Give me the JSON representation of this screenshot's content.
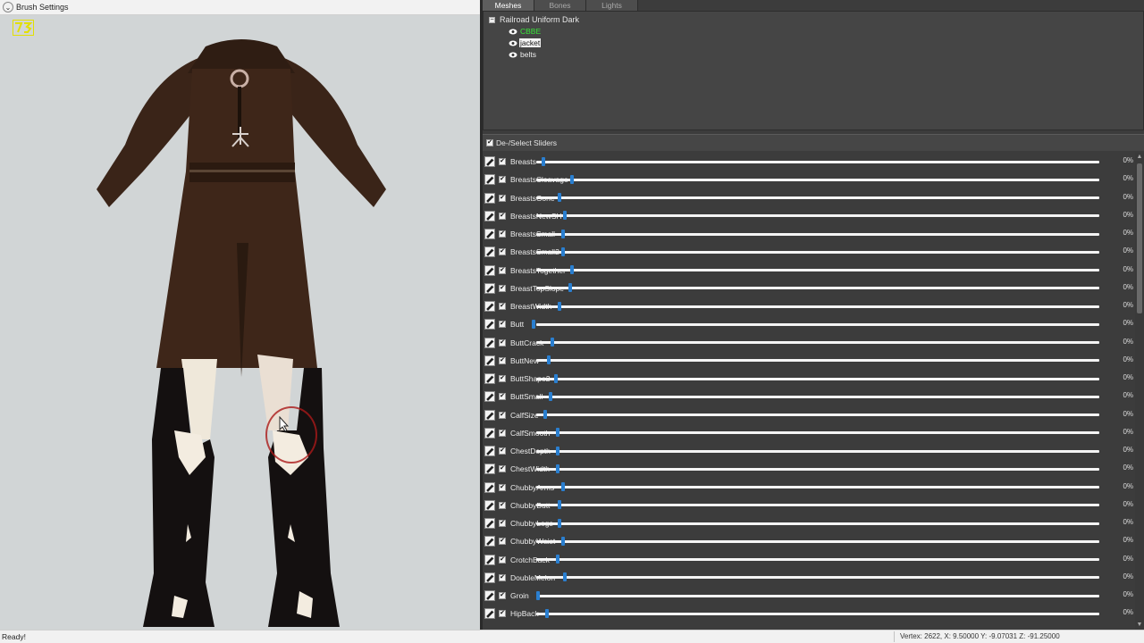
{
  "brush_bar": {
    "label": "Brush Settings",
    "toggle_icon": "chevron-down-icon"
  },
  "viewport": {
    "logo_text": "73",
    "logo_color": "#e2e000"
  },
  "tabs": [
    {
      "label": "Meshes",
      "active": true
    },
    {
      "label": "Bones",
      "active": false
    },
    {
      "label": "Lights",
      "active": false
    }
  ],
  "tree": {
    "root_label": "Railroad Uniform Dark",
    "collapse_glyph": "−",
    "meshes": [
      {
        "label": "CBBE",
        "style": "green"
      },
      {
        "label": "jacket",
        "style": "selected"
      },
      {
        "label": "belts",
        "style": "normal"
      }
    ]
  },
  "slider_panel": {
    "header_label": "De-/Select Sliders",
    "header_checked": true,
    "check_glyph": "✔",
    "sliders": [
      {
        "name": "Breasts",
        "value": 0,
        "pct": "0%"
      },
      {
        "name": "BreastsCleavage",
        "value": 0,
        "pct": "0%"
      },
      {
        "name": "BreastsGone",
        "value": 0,
        "pct": "0%"
      },
      {
        "name": "BreastsNewSH",
        "value": 0,
        "pct": "0%"
      },
      {
        "name": "BreastsSmall",
        "value": 0,
        "pct": "0%"
      },
      {
        "name": "BreastsSmall2",
        "value": 0,
        "pct": "0%"
      },
      {
        "name": "BreastsTogether",
        "value": 0,
        "pct": "0%"
      },
      {
        "name": "BreastTopSlope",
        "value": 0,
        "pct": "0%"
      },
      {
        "name": "BreastWidth",
        "value": 0,
        "pct": "0%"
      },
      {
        "name": "Butt",
        "value": 0,
        "pct": "0%"
      },
      {
        "name": "ButtCrack",
        "value": 0,
        "pct": "0%"
      },
      {
        "name": "ButtNew",
        "value": 0,
        "pct": "0%"
      },
      {
        "name": "ButtShape2",
        "value": 0,
        "pct": "0%"
      },
      {
        "name": "ButtSmall",
        "value": 0,
        "pct": "0%"
      },
      {
        "name": "CalfSize",
        "value": 0,
        "pct": "0%"
      },
      {
        "name": "CalfSmooth",
        "value": 0,
        "pct": "0%"
      },
      {
        "name": "ChestDepth",
        "value": 0,
        "pct": "0%"
      },
      {
        "name": "ChestWidth",
        "value": 0,
        "pct": "0%"
      },
      {
        "name": "ChubbyArms",
        "value": 0,
        "pct": "0%"
      },
      {
        "name": "ChubbyButt",
        "value": 0,
        "pct": "0%"
      },
      {
        "name": "ChubbyLegs",
        "value": 0,
        "pct": "0%"
      },
      {
        "name": "ChubbyWaist",
        "value": 0,
        "pct": "0%"
      },
      {
        "name": "CrotchBack",
        "value": 0,
        "pct": "0%"
      },
      {
        "name": "DoubleMelon",
        "value": 0,
        "pct": "0%"
      },
      {
        "name": "Groin",
        "value": 0,
        "pct": "0%"
      },
      {
        "name": "HipBack",
        "value": 0,
        "pct": "0%"
      }
    ]
  },
  "status": {
    "left": "Ready!",
    "right": "Vertex: 2622, X: 9.50000 Y: -9.07031 Z: -91.25000"
  },
  "colors": {
    "thumb": "#2a7fd0",
    "panel": "#3c3c3c",
    "viewport_bg": "#d1d5d6"
  }
}
